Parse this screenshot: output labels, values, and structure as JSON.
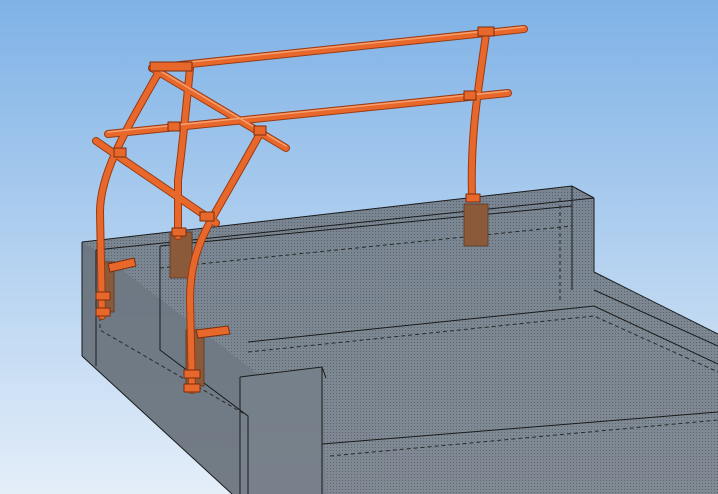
{
  "viewport": {
    "background_top": "#7fb2e6",
    "background_bottom": "#e4eef9"
  },
  "model": {
    "frame_color": "#e8682c",
    "frame_shadow": "#9a3a12",
    "frame_highlight": "#f6a070",
    "base_plate_color": "#8a5a3a",
    "box_fill": "#6d7780",
    "box_edge": "#1a1a1a",
    "box_hidden_edge": "#2a2a2a"
  }
}
